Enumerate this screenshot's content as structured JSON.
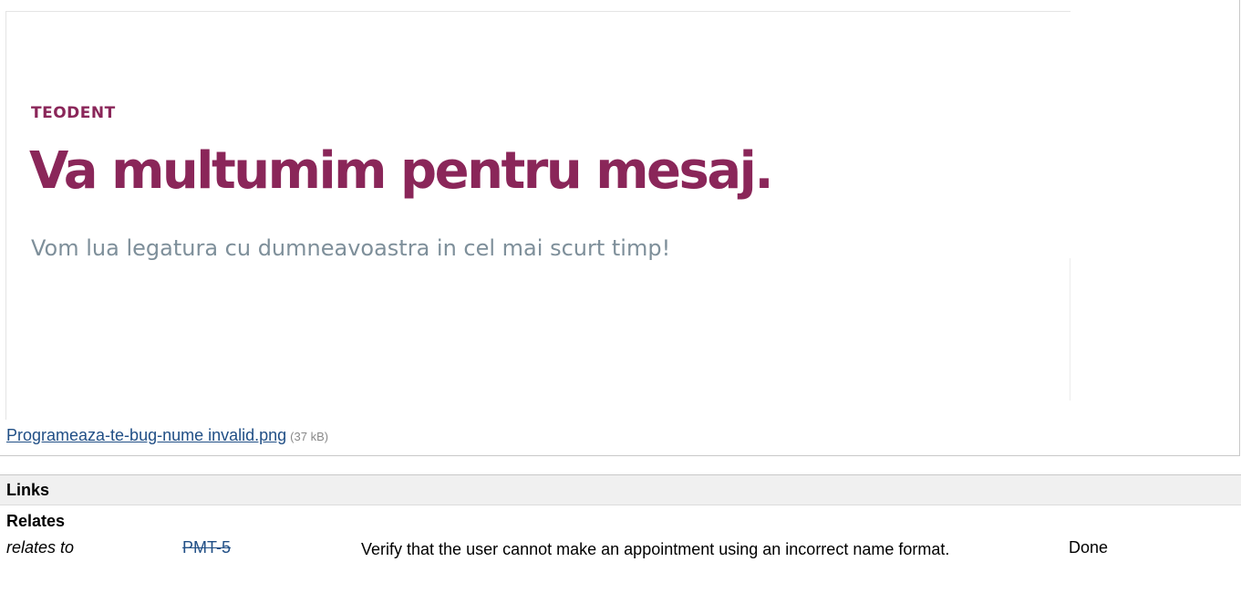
{
  "attachment": {
    "preview": {
      "brand": "TEODENT",
      "headline": "Va multumim pentru mesaj.",
      "subline": "Vom lua legatura cu dumneavoastra in cel mai scurt timp!"
    },
    "file_name": "Programeaza-te-bug-nume invalid.png",
    "file_size": "(37 kB)"
  },
  "links": {
    "title": "Links",
    "groups": [
      {
        "label": "Relates",
        "rows": [
          {
            "type": "relates to",
            "key": "PMT-5",
            "summary": "Verify that the user cannot make an appointment using an incorrect name format.",
            "status": "Done"
          }
        ]
      }
    ]
  },
  "colors": {
    "brand": "#8a2659",
    "subline": "#7e8f9a",
    "link": "#214f86"
  }
}
